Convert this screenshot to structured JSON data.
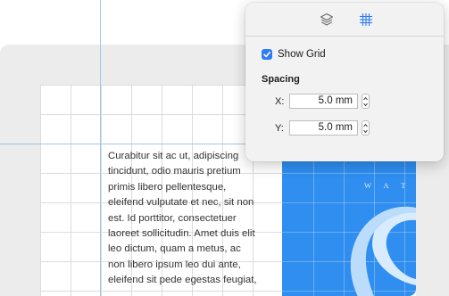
{
  "body_text": {
    "lines": [
      "Curabitur sit ac ut, adipiscing",
      "tincidunt, odio mauris pretium",
      "primis libero pellentesque,",
      "eleifend vulputate et nec, sit non",
      "est. Id porttitor, consectetuer",
      "laoreet sollicitudin. Amet duis elit",
      "leo dictum, quam a metus, ac",
      "non libero ipsum leo dui ante,",
      "eleifend sit pede egestas feugiat,"
    ]
  },
  "cover": {
    "letters": "W A T C"
  },
  "inspector": {
    "tabs": [
      {
        "icon": "layers-icon",
        "selected": false
      },
      {
        "icon": "grid-icon",
        "selected": true
      }
    ],
    "show_grid": {
      "label": "Show Grid",
      "checked": true
    },
    "spacing": {
      "title": "Spacing",
      "x": {
        "label": "X:",
        "value": "5.0 mm"
      },
      "y": {
        "label": "Y:",
        "value": "5.0 mm"
      }
    }
  },
  "colors": {
    "accent": "#2e7cf6",
    "grid_line": "#d9d9d9",
    "guide_line": "#9cc7ef",
    "cover_blue": "#2f8ef0"
  }
}
